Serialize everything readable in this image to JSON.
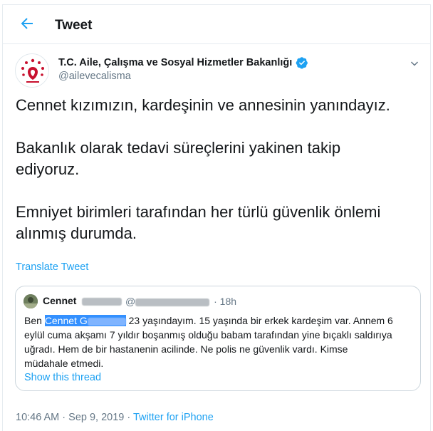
{
  "header": {
    "title": "Tweet"
  },
  "author": {
    "name": "T.C. Aile, Çalışma ve Sosyal Hizmetler Bakanlığı",
    "handle": "@ailevecalisma"
  },
  "tweet": {
    "lines": [
      "Cennet kızımızın, kardeşinin ve annesinin yanındayız.",
      "Bakanlık olarak tedavi süreçlerini yakinen takip",
      "ediyoruz.",
      "Emniyet birimleri tarafından her türlü güvenlik önlemi",
      "alınmış durumda."
    ],
    "translate_label": "Translate Tweet"
  },
  "quoted": {
    "name_visible": "Cennet",
    "handle_prefix": "@",
    "time": "18h",
    "text_before": "Ben ",
    "highlight_text": "Cennet G",
    "text_after_line1": " 23 yaşındayım. 15 yaşında bir erkek kardeşim var. Annem 6",
    "text_line2": "eylül cuma akşamı 7 yıldır boşanmış olduğu babam tarafından yine bıçaklı saldırıya",
    "text_line3": "uğradı. Hem de bir hastanenin acilinde. Ne polis ne güvenlik vardı. Kimse",
    "text_line4": "müdahale etmedi.",
    "thread_label": "Show this thread"
  },
  "meta": {
    "time": "10:46 AM · Sep 9, 2019 · ",
    "source": "Twitter for iPhone"
  },
  "colors": {
    "accent": "#1da1f2",
    "muted": "#657786",
    "ministry_red": "#c8102e"
  }
}
